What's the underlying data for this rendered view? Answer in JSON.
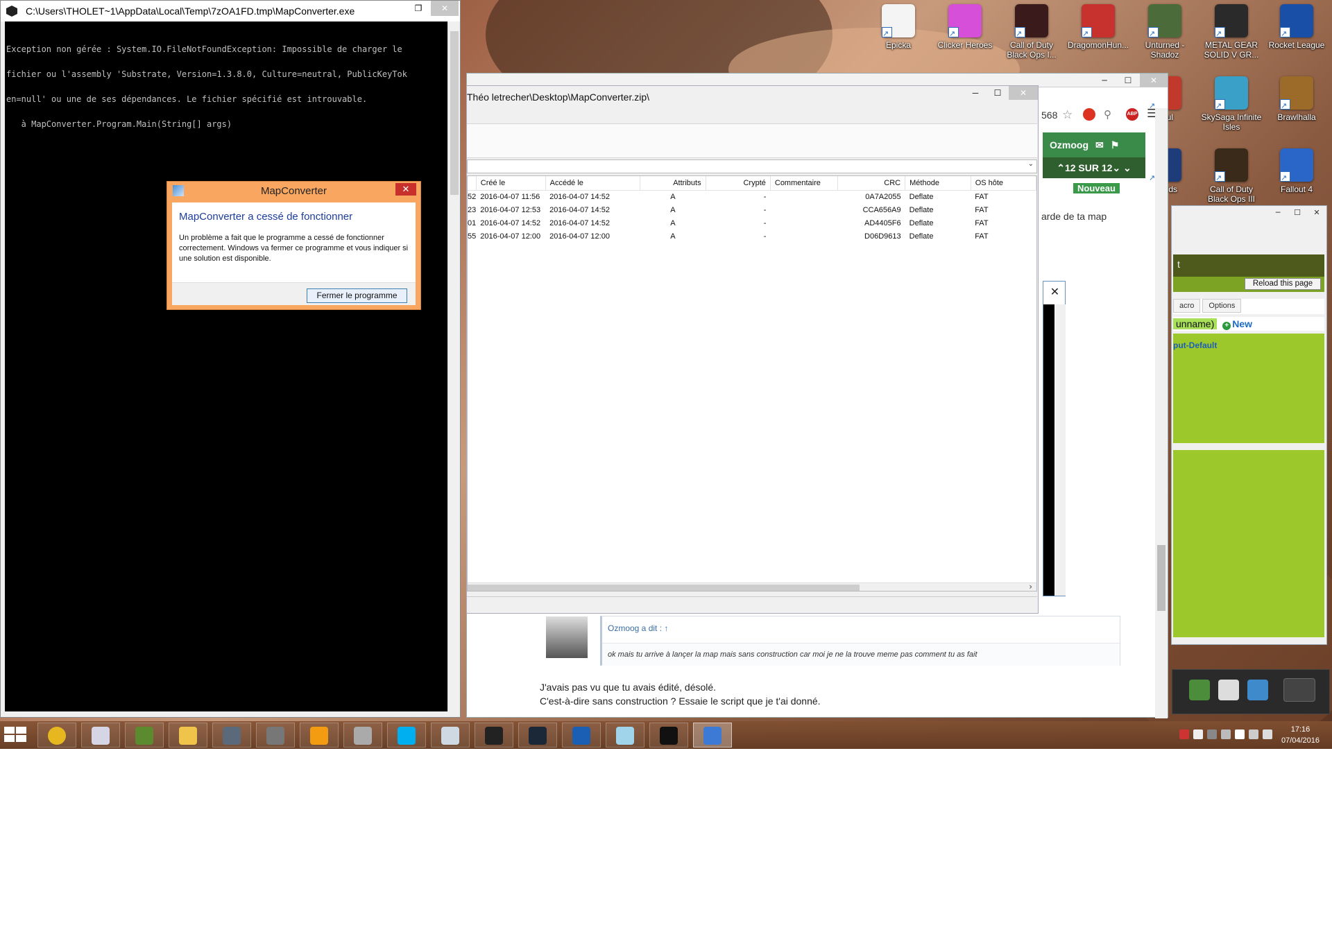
{
  "desktop": {
    "icons": [
      {
        "label": "Epicka",
        "color": "#f4f4f4"
      },
      {
        "label": "Clicker Heroes",
        "color": "#d64fd9"
      },
      {
        "label": "Call of Duty Black Ops I...",
        "color": "#3a1a1a"
      },
      {
        "label": "DragomonHun...",
        "color": "#c8322e"
      },
      {
        "label": "Unturned - Shadoz",
        "color": "#4c6b3a"
      },
      {
        "label": "METAL GEAR SOLID V GR...",
        "color": "#2a2a2a"
      },
      {
        "label": "Rocket League",
        "color": "#1a4fa8"
      },
      {
        "label": "Soul",
        "color": "#c0392b"
      },
      {
        "label": "SkySaga Infinite Isles",
        "color": "#3aa0c8"
      },
      {
        "label": "Brawlhalla",
        "color": "#9c6b2a"
      },
      {
        "label": "e of ds",
        "color": "#1e3b7a"
      },
      {
        "label": "Call of Duty Black Ops III",
        "color": "#3a2a1a"
      },
      {
        "label": "Fallout 4",
        "color": "#2a66c8"
      }
    ]
  },
  "console": {
    "title": "C:\\Users\\THOLET~1\\AppData\\Local\\Temp\\7zOA1FD.tmp\\MapConverter.exe",
    "lines": [
      "Exception non gérée : System.IO.FileNotFoundException: Impossible de charger le",
      "fichier ou l'assembly 'Substrate, Version=1.3.8.0, Culture=neutral, PublicKeyTok",
      "en=null' ou une de ses dépendances. Le fichier spécifié est introuvable.",
      "   à MapConverter.Program.Main(String[] args)"
    ]
  },
  "dialog": {
    "title": "MapConverter",
    "heading": "MapConverter a cessé de fonctionner",
    "message": "Un problème a fait que le programme a cessé de fonctionner correctement. Windows va fermer ce programme et vous indiquer si une solution est disponible.",
    "button": "Fermer le programme"
  },
  "zip": {
    "title": "Théo letrecher\\Desktop\\MapConverter.zip\\",
    "columns": [
      "Créé le",
      "Accédé le",
      "Attributs",
      "Crypté",
      "Commentaire",
      "CRC",
      "Méthode",
      "OS hôte"
    ],
    "rows": [
      {
        "prefix": "52",
        "created": "2016-04-07 11:56",
        "accessed": "2016-04-07 14:52",
        "attr": "A",
        "enc": "-",
        "comment": "",
        "crc": "0A7A2055",
        "method": "Deflate",
        "os": "FAT"
      },
      {
        "prefix": "23",
        "created": "2016-04-07 12:53",
        "accessed": "2016-04-07 14:52",
        "attr": "A",
        "enc": "-",
        "comment": "",
        "crc": "CCA656A9",
        "method": "Deflate",
        "os": "FAT"
      },
      {
        "prefix": "01",
        "created": "2016-04-07 14:52",
        "accessed": "2016-04-07 14:52",
        "attr": "A",
        "enc": "-",
        "comment": "",
        "crc": "AD4405F6",
        "method": "Deflate",
        "os": "FAT"
      },
      {
        "prefix": "55",
        "created": "2016-04-07 12:00",
        "accessed": "2016-04-07 12:00",
        "attr": "A",
        "enc": "-",
        "comment": "",
        "crc": "D06D9613",
        "method": "Deflate",
        "os": "FAT"
      }
    ]
  },
  "browser": {
    "url_fragment": "568",
    "username": "Ozmoog",
    "pager": "12 SUR 12",
    "badge": "Nouveau",
    "snippet": "arde de ta map",
    "quote_author": "Ozmoog a dit : ↑",
    "quote_text": "ok mais tu arrive à lançer la map mais sans construction car moi je ne la trouve meme pas comment tu as fait",
    "post_lines": [
      "J'avais pas vu que tu avais édité, désolé.",
      "C'est-à-dire sans construction ? Essaie le script que je t'ai donné."
    ]
  },
  "right_panel": {
    "title_fragment": "t",
    "reload": "Reload this page",
    "tabs": [
      "acro",
      "Options"
    ],
    "unname": "unname)",
    "new": "New",
    "input_label": "put-Default"
  },
  "taskbar": {
    "apps": [
      "chrome",
      "pidgin",
      "minecraft",
      "file-explorer",
      "steam-like",
      "game-controller",
      "media-player",
      "disc",
      "skype",
      "photo",
      "7zip",
      "steam",
      "rocket-league",
      "glass",
      "cube",
      "mapconverter"
    ],
    "time": "17:16",
    "date": "07/04/2016"
  }
}
